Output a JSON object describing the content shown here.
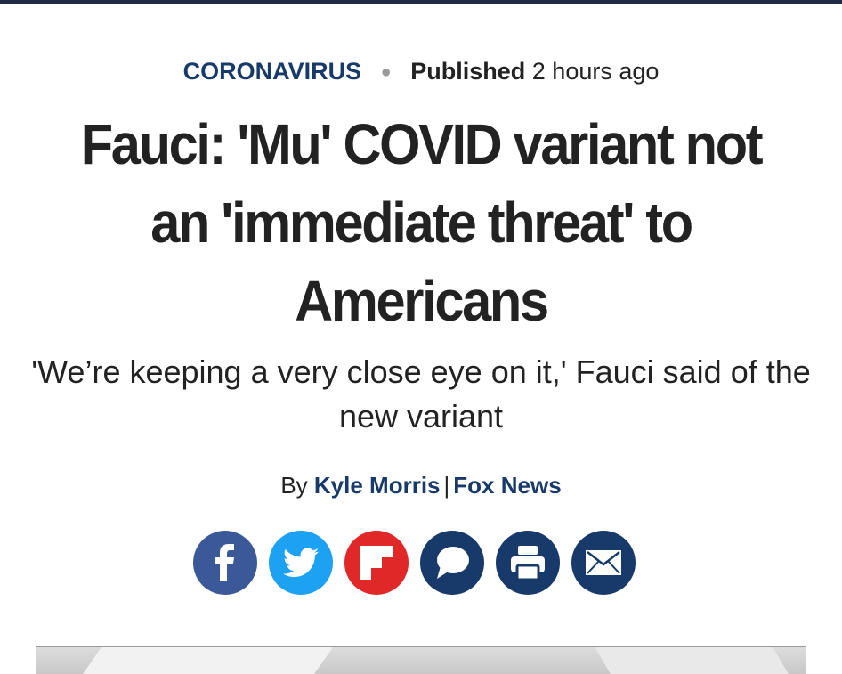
{
  "article": {
    "category": "CORONAVIRUS",
    "published_label": "Published",
    "published_time": "2 hours ago",
    "headline": "Fauci: 'Mu' COVID variant not an 'immediate threat' to Americans",
    "dek": "'We’re keeping a very close eye on it,' Fauci said of the new variant",
    "byline_prefix": "By",
    "author": "Kyle Morris",
    "byline_separator": "|",
    "outlet": "Fox News"
  },
  "share": {
    "buttons": [
      {
        "name": "facebook",
        "icon": "facebook-icon",
        "color": "#3b5998"
      },
      {
        "name": "twitter",
        "icon": "twitter-icon",
        "color": "#1da1f2"
      },
      {
        "name": "flipboard",
        "icon": "flipboard-icon",
        "color": "#e12828"
      },
      {
        "name": "comments",
        "icon": "comment-icon",
        "color": "#183a6b"
      },
      {
        "name": "print",
        "icon": "print-icon",
        "color": "#183a6b"
      },
      {
        "name": "email",
        "icon": "email-icon",
        "color": "#183a6b"
      }
    ]
  },
  "colors": {
    "brand_navy": "#183a6b",
    "text": "#222222",
    "top_bar": "#1f2a44"
  }
}
